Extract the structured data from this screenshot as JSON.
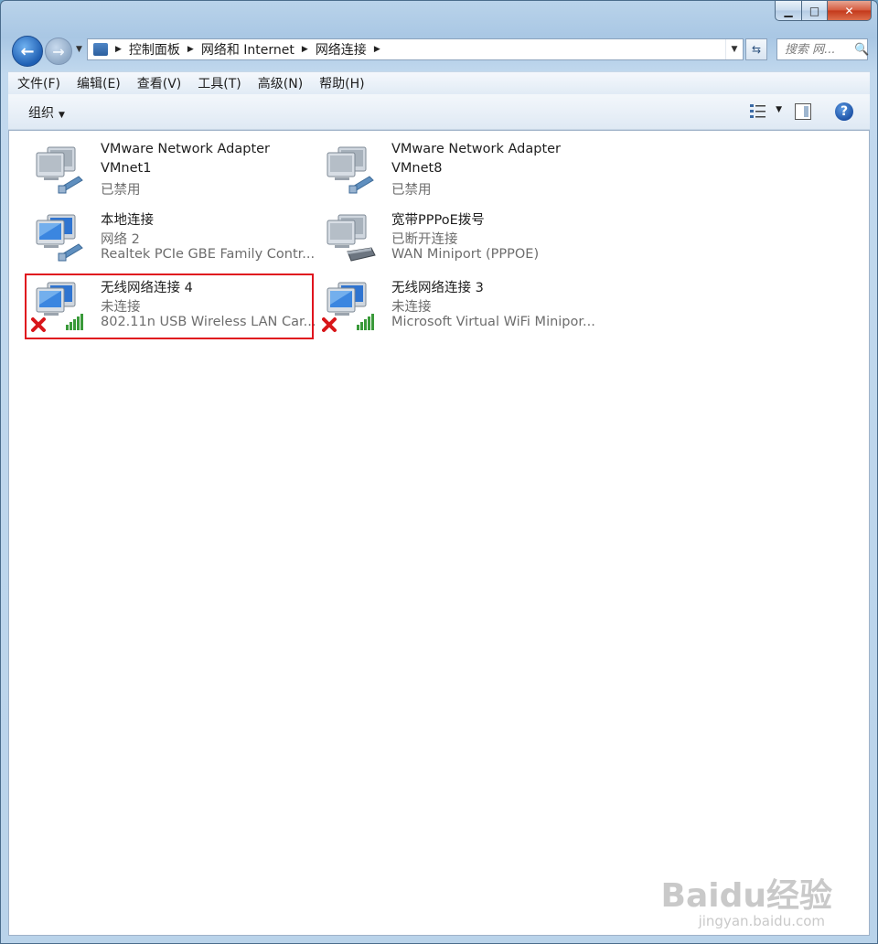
{
  "window": {
    "caption": {
      "minimize_glyph": "▁",
      "maximize_glyph": "□",
      "close_glyph": "✕"
    }
  },
  "nav": {
    "back_glyph": "←",
    "forward_glyph": "→",
    "breadcrumb": [
      "控制面板",
      "网络和 Internet",
      "网络连接"
    ],
    "search_placeholder": "搜索 网...",
    "refresh_glyph": "⇆",
    "search_icon": "magnifier-icon"
  },
  "menubar": {
    "items": [
      "文件(F)",
      "编辑(E)",
      "查看(V)",
      "工具(T)",
      "高级(N)",
      "帮助(H)"
    ]
  },
  "cmdbar": {
    "organize_label": "组织",
    "help_glyph": "?"
  },
  "connections": [
    {
      "line1": "VMware Network Adapter",
      "line2": "VMnet1",
      "line3": "已禁用",
      "kind": "wired"
    },
    {
      "line1": "VMware Network Adapter",
      "line2": "VMnet8",
      "line3": "已禁用",
      "kind": "wired"
    },
    {
      "line1": "本地连接",
      "line2": "网络  2",
      "line3": "Realtek PCIe GBE Family Contr...",
      "kind": "wired"
    },
    {
      "line1": "宽带PPPoE拨号",
      "line2": "已断开连接",
      "line3": "WAN Miniport (PPPOE)",
      "kind": "modem"
    },
    {
      "line1": "无线网络连接 4",
      "line2": "未连接",
      "line3": "802.11n USB Wireless LAN Car...",
      "kind": "wireless"
    },
    {
      "line1": "无线网络连接 3",
      "line2": "未连接",
      "line3": "Microsoft Virtual WiFi Minipor...",
      "kind": "wireless"
    }
  ],
  "watermark": {
    "brand": "Baidu经验",
    "url": "jingyan.baidu.com"
  },
  "colors": {
    "highlight": "#e0141e",
    "accent": "#1f5fb3"
  }
}
